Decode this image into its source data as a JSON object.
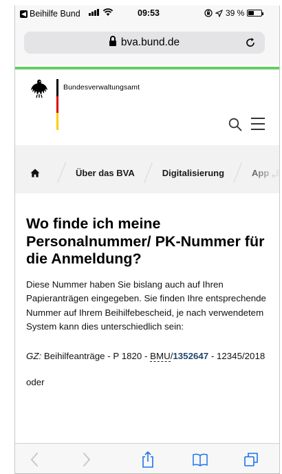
{
  "statusbar": {
    "back_app": "Beihilfe Bund",
    "time": "09:53",
    "battery_pct": "39 %"
  },
  "browser": {
    "url": "bva.bund.de"
  },
  "site": {
    "org_name": "Bundesverwaltungsamt"
  },
  "breadcrumb": {
    "items": [
      "Über das BVA",
      "Digitalisierung",
      "App „Beihilfe"
    ]
  },
  "article": {
    "headline": "Wo finde ich meine Personalnummer/ PK-Nummer für die Anmeldung?",
    "paragraph": "Diese Nummer haben Sie bislang auch auf Ihren Papieranträgen eingegeben. Sie finden Ihre entsprechende Nummer auf Ihrem Beihilfebescheid, je nach verwendetem System kann dies unterschiedlich sein:",
    "gz_label": "GZ:",
    "gz_prefix": " Beihilfeanträge - P 1820 - ",
    "gz_abbr": "BMU",
    "gz_slash": "/",
    "gz_number": "1352647",
    "gz_suffix": " - 12345/2018",
    "or_text": "oder"
  },
  "colors": {
    "accent_green": "#66cc66",
    "link_blue": "#24466c"
  }
}
